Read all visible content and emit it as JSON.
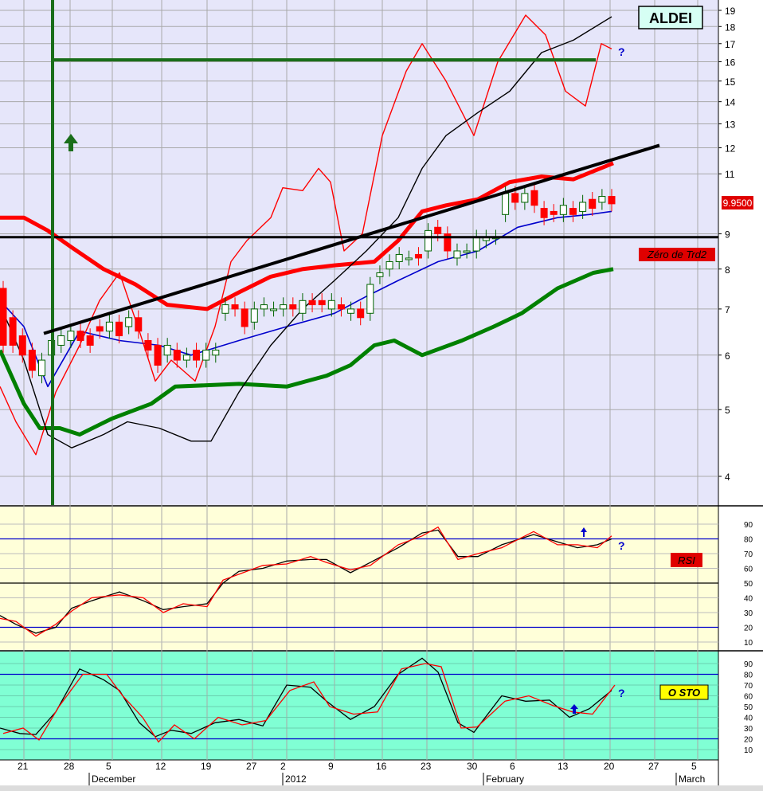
{
  "chart_data": [
    {
      "type": "candlestick",
      "title": "ALDEI",
      "y_scale": "log",
      "ylim": [
        3.6,
        20
      ],
      "y_ticks": [
        "19",
        "18",
        "17",
        "16",
        "15",
        "14",
        "13",
        "12",
        "11",
        "9",
        "8",
        "7",
        "6",
        "5",
        "4"
      ],
      "last_price": "9.9500",
      "annotation": "Zéro de Trd2",
      "question_mark": "?",
      "horizontal_levels": [
        16.1,
        8.9
      ],
      "trendline": {
        "from": [
          "Nov 25",
          6.4
        ],
        "to": [
          "Feb 22",
          12.1
        ]
      },
      "vertical_marker": "Nov 25",
      "series": [
        {
          "name": "",
          "color": "#ff0000",
          "kind": "thick-band-upper"
        },
        {
          "name": "",
          "color": "#007700",
          "kind": "thick-band-lower"
        },
        {
          "name": "",
          "color": "#0000cc",
          "kind": "moving-average"
        },
        {
          "name": "",
          "color": "#ff0000",
          "kind": "oscillator-overlay"
        },
        {
          "name": "",
          "color": "#000000",
          "kind": "oscillator-overlay"
        }
      ],
      "candles_approx": [
        [
          7.5,
          6.2
        ],
        [
          6.8,
          6.2
        ],
        [
          6.4,
          6.0
        ],
        [
          6.1,
          5.7
        ],
        [
          5.6,
          5.9
        ],
        [
          6.0,
          6.3
        ],
        [
          6.2,
          6.4
        ],
        [
          6.3,
          6.5
        ],
        [
          6.5,
          6.3
        ],
        [
          6.4,
          6.2
        ],
        [
          6.6,
          6.5
        ],
        [
          6.5,
          6.7
        ],
        [
          6.7,
          6.4
        ],
        [
          6.6,
          6.8
        ],
        [
          6.8,
          6.5
        ],
        [
          6.3,
          6.1
        ],
        [
          6.2,
          5.8
        ],
        [
          6.0,
          6.2
        ],
        [
          6.1,
          5.9
        ],
        [
          5.9,
          6.0
        ],
        [
          6.1,
          5.9
        ],
        [
          5.9,
          6.1
        ],
        [
          6.0,
          6.1
        ],
        [
          6.9,
          7.1
        ],
        [
          7.1,
          7.0
        ],
        [
          7.0,
          6.6
        ],
        [
          6.7,
          7.0
        ],
        [
          7.0,
          7.1
        ],
        [
          7.0,
          7.0
        ],
        [
          7.0,
          7.1
        ],
        [
          7.1,
          7.0
        ],
        [
          6.9,
          7.2
        ],
        [
          7.2,
          7.1
        ],
        [
          7.2,
          7.1
        ],
        [
          7.0,
          7.2
        ],
        [
          7.1,
          7.0
        ],
        [
          6.9,
          7.0
        ],
        [
          7.0,
          6.8
        ],
        [
          6.9,
          7.6
        ],
        [
          7.8,
          7.9
        ],
        [
          8.0,
          8.2
        ],
        [
          8.2,
          8.4
        ],
        [
          8.3,
          8.3
        ],
        [
          8.4,
          8.3
        ],
        [
          8.5,
          9.1
        ],
        [
          9.2,
          9.0
        ],
        [
          9.0,
          8.5
        ],
        [
          8.3,
          8.5
        ],
        [
          8.5,
          8.5
        ],
        [
          8.5,
          8.9
        ],
        [
          8.8,
          8.9
        ],
        [
          8.9,
          8.9
        ],
        [
          9.6,
          10.3
        ],
        [
          10.3,
          10.0
        ],
        [
          10.0,
          10.3
        ],
        [
          10.4,
          9.9
        ],
        [
          9.8,
          9.5
        ],
        [
          9.7,
          9.6
        ],
        [
          9.6,
          9.9
        ],
        [
          9.8,
          9.6
        ],
        [
          9.7,
          10.0
        ],
        [
          10.1,
          9.8
        ],
        [
          10.0,
          10.2
        ],
        [
          10.2,
          9.95
        ]
      ]
    },
    {
      "type": "line",
      "title": "RSI",
      "ylim": [
        0,
        100
      ],
      "y_ticks": [
        "90",
        "80",
        "70",
        "60",
        "50",
        "40",
        "30",
        "20",
        "10"
      ],
      "levels": [
        80,
        50,
        20
      ],
      "question_mark": "?",
      "series": [
        {
          "name": "",
          "color": "#ff0000"
        },
        {
          "name": "",
          "color": "#000000"
        }
      ]
    },
    {
      "type": "line",
      "title": "O STO",
      "ylim": [
        0,
        100
      ],
      "y_ticks": [
        "90",
        "80",
        "70",
        "60",
        "50",
        "40",
        "30",
        "20",
        "10"
      ],
      "levels": [
        80,
        20
      ],
      "question_mark": "?",
      "series": [
        {
          "name": "",
          "color": "#ff0000"
        },
        {
          "name": "",
          "color": "#000000"
        }
      ]
    }
  ],
  "x_axis": {
    "day_labels": [
      "21",
      "28",
      "5",
      "12",
      "19",
      "27",
      "2",
      "9",
      "16",
      "23",
      "30",
      "6",
      "13",
      "20",
      "27",
      "5"
    ],
    "month_labels": [
      "December",
      "2012",
      "February",
      "March"
    ]
  },
  "colors": {
    "price_bg": "#e6e6fa",
    "rsi_bg": "#ffffd9",
    "sto_bg": "#80ffd4",
    "axis_bg": "#ffffff",
    "grid": "#9a9a9a",
    "band_red": "#ff0000",
    "band_green": "#008000",
    "level_blue": "#0000cc",
    "frame_green": "#1a6e1a"
  }
}
